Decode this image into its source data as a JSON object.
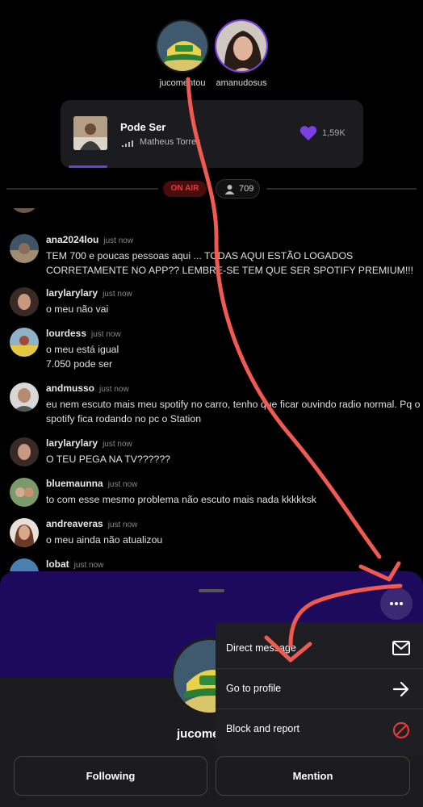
{
  "hosts": [
    {
      "username": "jucomentou"
    },
    {
      "username": "amanudosus"
    }
  ],
  "now_playing": {
    "title": "Pode Ser",
    "artist": "Matheus Torres",
    "likes": "1,59K"
  },
  "status": {
    "on_air": "ON AIR",
    "listeners": "709"
  },
  "chat": [
    {
      "user": "ana2024lou",
      "time": "just now",
      "text": "TEM 700 e poucas pessoas aqui ... TODAS AQUI ESTÃO LOGADOS CORRETAMENTE NO APP?? LEMBRE-SE TEM QUE SER SPOTIFY PREMIUM!!!"
    },
    {
      "user": "larylarylary",
      "time": "just now",
      "text": "o meu não vai"
    },
    {
      "user": "lourdess",
      "time": "just now",
      "text": "o meu está igual\n7.050 pode ser"
    },
    {
      "user": "andmusso",
      "time": "just now",
      "text": "eu nem escuto mais meu spotify no carro, tenho que ficar ouvindo radio normal. Pq o spotify fica rodando no pc o Station"
    },
    {
      "user": "larylarylary",
      "time": "just now",
      "text": "O TEU PEGA NA TV??????"
    },
    {
      "user": "bluemaunna",
      "time": "just now",
      "text": "to com esse mesmo problema não escuto mais nada kkkkksk"
    },
    {
      "user": "andreaveras",
      "time": "just now",
      "text": "o meu ainda não atualizou"
    },
    {
      "user": "lobat",
      "time": "just now",
      "text": ""
    }
  ],
  "profile_sheet": {
    "name": "jucome",
    "following_label": "Following",
    "mention_label": "Mention"
  },
  "menu": {
    "direct_message": "Direct message",
    "go_to_profile": "Go to profile",
    "block_and_report": "Block and report"
  },
  "colors": {
    "accent_purple": "#6a3fd8",
    "sheet_band": "#1e0a5c",
    "on_air_red": "#e33a3a",
    "annotation_red": "#f05a50"
  }
}
